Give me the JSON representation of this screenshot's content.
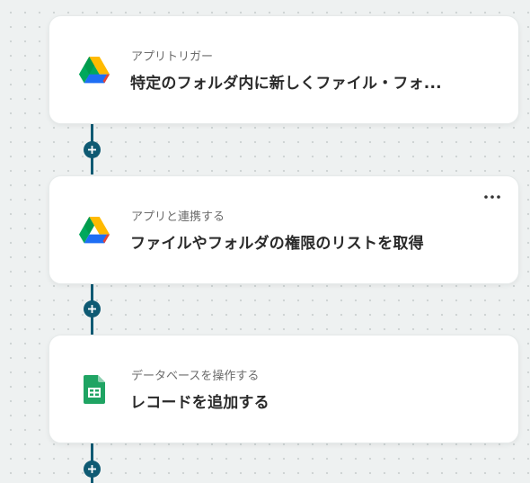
{
  "steps": [
    {
      "subtitle": "アプリトリガー",
      "title": "特定のフォルダ内に新しくファイル・フォ...",
      "icon": "google-drive-icon"
    },
    {
      "subtitle": "アプリと連携する",
      "title": "ファイルやフォルダの権限のリストを取得",
      "icon": "google-drive-icon",
      "more_icon": "more-horizontal-icon"
    },
    {
      "subtitle": "データベースを操作する",
      "title": "レコードを追加する",
      "icon": "google-sheets-icon"
    }
  ],
  "colors": {
    "connector": "#0e5a73",
    "background": "#eef1f1",
    "card": "#ffffff"
  }
}
